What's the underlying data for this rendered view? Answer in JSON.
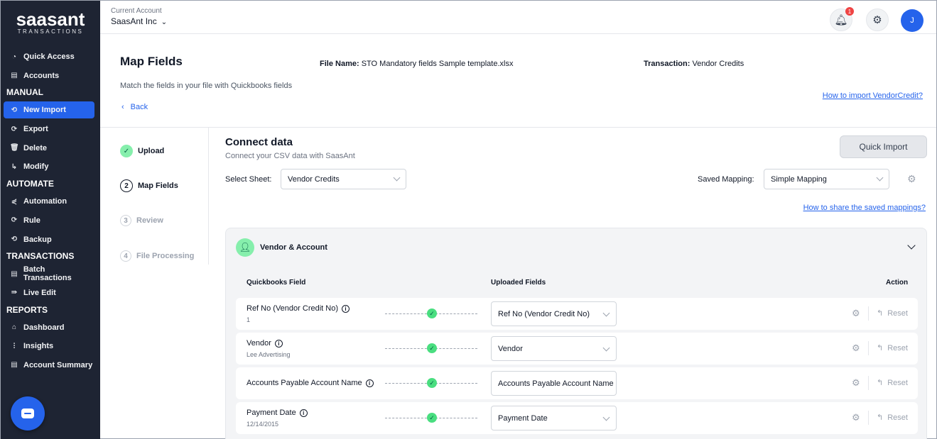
{
  "brand": {
    "logo_main": "saasant",
    "logo_sub": "TRANSACTIONS"
  },
  "sidebar": {
    "items_top": [
      {
        "label": "Quick Access",
        "icon": "clock-icon"
      },
      {
        "label": "Accounts",
        "icon": "clipboard-icon"
      }
    ],
    "sections": [
      {
        "heading": "MANUAL",
        "items": [
          {
            "label": "New Import",
            "icon": "import-icon",
            "active": true
          },
          {
            "label": "Export",
            "icon": "export-icon"
          },
          {
            "label": "Delete",
            "icon": "trash-icon"
          },
          {
            "label": "Modify",
            "icon": "edit-icon"
          }
        ]
      },
      {
        "heading": "AUTOMATE",
        "items": [
          {
            "label": "Automation",
            "icon": "share-icon"
          },
          {
            "label": "Rule",
            "icon": "rule-icon"
          },
          {
            "label": "Backup",
            "icon": "backup-icon"
          }
        ]
      },
      {
        "heading": "TRANSACTIONS",
        "items": [
          {
            "label": "Batch Transactions",
            "icon": "document-icon"
          },
          {
            "label": "Live Edit",
            "icon": "live-edit-icon"
          }
        ]
      },
      {
        "heading": "REPORTS",
        "items": [
          {
            "label": "Dashboard",
            "icon": "home-icon"
          },
          {
            "label": "Insights",
            "icon": "sliders-icon"
          },
          {
            "label": "Account Summary",
            "icon": "clipboard-icon"
          }
        ]
      }
    ]
  },
  "topbar": {
    "account_label": "Current Account",
    "account_name": "SaasAnt Inc",
    "notification_count": "1",
    "avatar_initial": "J"
  },
  "header": {
    "title": "Map Fields",
    "file_name_label": "File Name:",
    "file_name": "STO Mandatory fields Sample template.xlsx",
    "transaction_label": "Transaction:",
    "transaction": "Vendor Credits",
    "subtitle": "Match the fields in your file with Quickbooks fields",
    "help_link": "How to import VendorCredit?",
    "back_label": "Back"
  },
  "stepper": [
    {
      "num": "✓",
      "label": "Upload",
      "state": "done"
    },
    {
      "num": "2",
      "label": "Map Fields",
      "state": "current"
    },
    {
      "num": "3",
      "label": "Review",
      "state": "pending"
    },
    {
      "num": "4",
      "label": "File Processing",
      "state": "pending"
    }
  ],
  "connect": {
    "title": "Connect data",
    "subtitle": "Connect your CSV data with SaasAnt",
    "quick_import": "Quick Import",
    "select_sheet_label": "Select Sheet:",
    "select_sheet_value": "Vendor Credits",
    "saved_mapping_label": "Saved Mapping:",
    "saved_mapping_value": "Simple Mapping",
    "share_link": "How to share the saved mappings?"
  },
  "mapping": {
    "section_title": "Vendor & Account",
    "columns": {
      "qb_field": "Quickbooks Field",
      "uploaded": "Uploaded Fields",
      "action": "Action"
    },
    "reset_label": "Reset",
    "rows": [
      {
        "field": "Ref No (Vendor Credit No)",
        "value": "1",
        "uploaded": "Ref No (Vendor Credit No)",
        "dropdown": true
      },
      {
        "field": "Vendor",
        "value": "Lee Advertising",
        "uploaded": "Vendor",
        "dropdown": true
      },
      {
        "field": "Accounts Payable Account Name",
        "value": "",
        "uploaded": "Accounts Payable Account Name",
        "dropdown": false
      },
      {
        "field": "Payment Date",
        "value": "12/14/2015",
        "uploaded": "Payment Date",
        "dropdown": true
      }
    ]
  },
  "colors": {
    "sidebar_bg": "#1e2433",
    "accent": "#2563eb",
    "success": "#4ade80"
  }
}
